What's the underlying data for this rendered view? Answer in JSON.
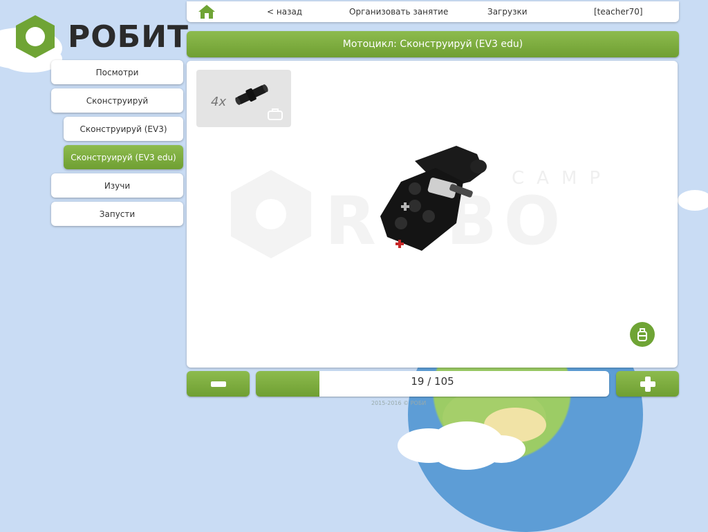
{
  "brand": {
    "name": "РОБИТ",
    "color": "#6fa435"
  },
  "topbar": {
    "home_icon": "home-icon",
    "back_label": "< назад",
    "organize_label": "Организовать занятие",
    "downloads_label": "Загрузки",
    "user_label": "[teacher70]"
  },
  "title": "Мотоцикл: Сконструируй (EV3 edu)",
  "sidebar": {
    "items": [
      {
        "label": "Посмотри"
      },
      {
        "label": "Сконструируй"
      },
      {
        "label": "Сконструируй (EV3)"
      },
      {
        "label": "Сконструируй (EV3 edu)",
        "active": true
      },
      {
        "label": "Изучи"
      },
      {
        "label": "Запусти"
      }
    ]
  },
  "parts": {
    "count_label": "4x",
    "icon": "connector-peg-icon",
    "bag_icon": "bag-icon"
  },
  "watermark": {
    "text": "CAMP ROBO"
  },
  "pager": {
    "current": 19,
    "total": 105,
    "label": "19 / 105",
    "minus_icon": "minus-icon",
    "plus_icon": "plus-icon"
  },
  "footer": "2015-2016 © РОБИ"
}
